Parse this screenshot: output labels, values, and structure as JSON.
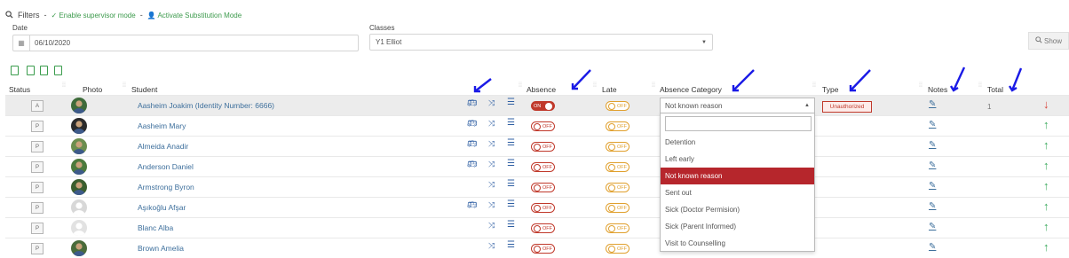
{
  "filters": {
    "icon": "search-icon",
    "label": "Filters",
    "sep": "-",
    "supervisor_mode": "Enable supervisor mode",
    "substitution_mode": "Activate Substitution Mode"
  },
  "date_filter": {
    "label": "Date",
    "value": "06/10/2020",
    "icon": "calendar-icon"
  },
  "classes_filter": {
    "label": "Classes",
    "value": "Y1 Elliot"
  },
  "show_button": {
    "label": "Show",
    "icon": "search-icon"
  },
  "export_icons": [
    "print-icon",
    "excel-icon",
    "csv-icon",
    "copy-icon"
  ],
  "columns": {
    "status": "Status",
    "photo": "Photo",
    "student": "Student",
    "absence": "Absence",
    "late": "Late",
    "absence_category": "Absence Category",
    "type": "Type",
    "notes": "Notes",
    "total": "Total"
  },
  "toggle_labels": {
    "on": "ON",
    "off": "OFF"
  },
  "rows": [
    {
      "status": "A",
      "name": "Aasheim Joakim (Identity Number: 6666)",
      "bus": true,
      "absent": true,
      "category": "Not known reason",
      "type": "Unauthorized",
      "total": "1",
      "arrow": "↓"
    },
    {
      "status": "P",
      "name": "Aasheim Mary",
      "bus": true,
      "absent": false,
      "arrow": "↑"
    },
    {
      "status": "P",
      "name": "Almeida Anadir",
      "bus": true,
      "absent": false,
      "arrow": "↑"
    },
    {
      "status": "P",
      "name": "Anderson Daniel",
      "bus": true,
      "absent": false,
      "arrow": "↑"
    },
    {
      "status": "P",
      "name": "Armstrong Byron",
      "bus": false,
      "absent": false,
      "arrow": "↑"
    },
    {
      "status": "P",
      "name": "Aşıkoğlu Afşar",
      "bus": true,
      "absent": false,
      "arrow": "↑"
    },
    {
      "status": "P",
      "name": "Blanc Alba",
      "bus": false,
      "absent": false,
      "arrow": "↑"
    },
    {
      "status": "P",
      "name": "Brown Amelia",
      "bus": false,
      "absent": false,
      "arrow": "↑"
    }
  ],
  "absence_dropdown": {
    "selected": "Not known reason",
    "options": [
      "Detention",
      "Left early",
      "Not known reason",
      "Sent out",
      "Sick (Doctor Permision)",
      "Sick (Parent Informed)",
      "Visit to Counselling"
    ],
    "active_index": 2
  },
  "colors": {
    "accent": "#b6262c",
    "link": "#3d6f9c",
    "green": "#3a9c4c",
    "late": "#e0a02e",
    "annotation": "#1a1ae6"
  }
}
